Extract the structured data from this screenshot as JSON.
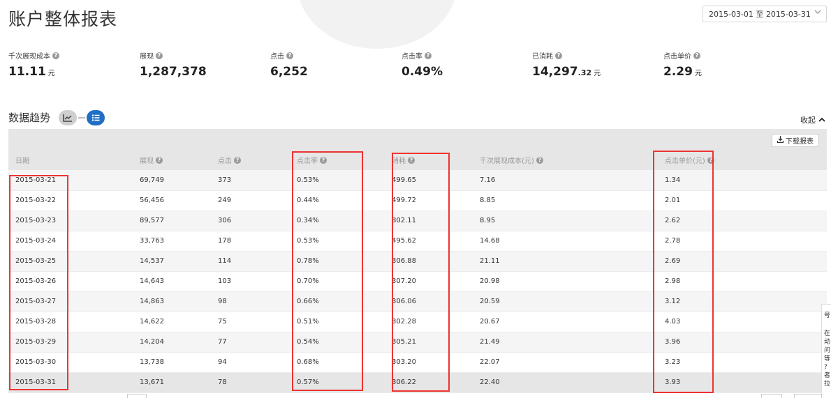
{
  "page": {
    "title": "账户整体报表",
    "date_range": "2015-03-01  至  2015-03-31"
  },
  "metrics": [
    {
      "label": "千次展现成本",
      "value": "11.11",
      "decimal": "",
      "unit": "元"
    },
    {
      "label": "展现",
      "value": "1,287,378",
      "decimal": "",
      "unit": ""
    },
    {
      "label": "点击",
      "value": "6,252",
      "decimal": "",
      "unit": ""
    },
    {
      "label": "点击率",
      "value": "0.49%",
      "decimal": "",
      "unit": ""
    },
    {
      "label": "已消耗",
      "value": "14,297",
      "decimal": ".32",
      "unit": "元"
    },
    {
      "label": "点击单价",
      "value": "2.29",
      "decimal": "",
      "unit": "元"
    }
  ],
  "trend": {
    "title": "数据趋势",
    "collapse_label": "收起",
    "download_label": "下载报表"
  },
  "table": {
    "columns": [
      "日期",
      "展现",
      "点击",
      "点击率",
      "消耗",
      "千次展现成本(元)",
      "点击单价(元)"
    ],
    "rows": [
      [
        "2015-03-21",
        "69,749",
        "373",
        "0.53%",
        "499.65",
        "7.16",
        "1.34"
      ],
      [
        "2015-03-22",
        "56,456",
        "249",
        "0.44%",
        "499.72",
        "8.85",
        "2.01"
      ],
      [
        "2015-03-23",
        "89,577",
        "306",
        "0.34%",
        "802.11",
        "8.95",
        "2.62"
      ],
      [
        "2015-03-24",
        "33,763",
        "178",
        "0.53%",
        "495.62",
        "14.68",
        "2.78"
      ],
      [
        "2015-03-25",
        "14,537",
        "114",
        "0.78%",
        "306.88",
        "21.11",
        "2.69"
      ],
      [
        "2015-03-26",
        "14,643",
        "103",
        "0.70%",
        "307.20",
        "20.98",
        "2.98"
      ],
      [
        "2015-03-27",
        "14,863",
        "98",
        "0.66%",
        "306.06",
        "20.59",
        "3.12"
      ],
      [
        "2015-03-28",
        "14,622",
        "75",
        "0.51%",
        "302.28",
        "20.67",
        "4.03"
      ],
      [
        "2015-03-29",
        "14,204",
        "77",
        "0.54%",
        "305.21",
        "21.49",
        "3.96"
      ],
      [
        "2015-03-30",
        "13,738",
        "94",
        "0.68%",
        "303.20",
        "22.07",
        "3.23"
      ],
      [
        "2015-03-31",
        "13,671",
        "78",
        "0.57%",
        "306.22",
        "22.40",
        "3.93"
      ]
    ]
  },
  "side_widget": {
    "chars": [
      "号",
      "在",
      "动",
      "问",
      "等",
      "?",
      "者",
      "拉"
    ]
  },
  "colors": {
    "accent": "#1f6fc5",
    "highlight": "#e33333"
  }
}
